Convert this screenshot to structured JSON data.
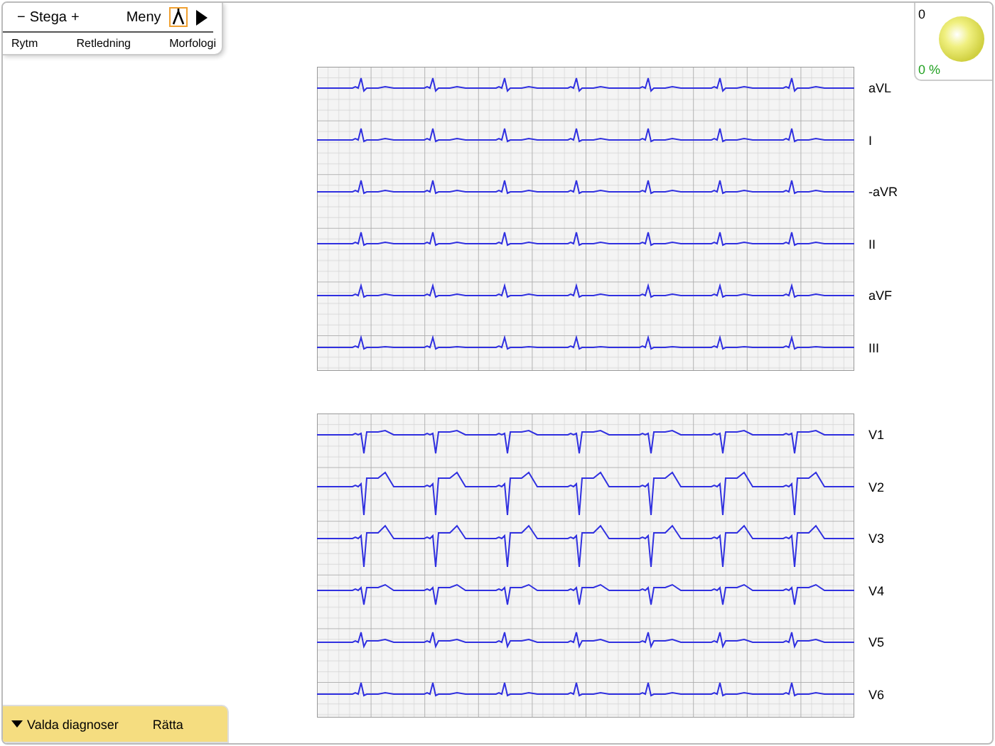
{
  "toolbar": {
    "minus": "−",
    "step_label": "Stega",
    "plus": "+",
    "menu": "Meny",
    "tabs": [
      "Rytm",
      "Retledning",
      "Morfologi"
    ]
  },
  "score": {
    "points": "0",
    "percent": "0 %"
  },
  "ecg_panels": [
    {
      "leads": [
        "aVL",
        "I",
        "-aVR",
        "II",
        "aVF",
        "III"
      ]
    },
    {
      "leads": [
        "V1",
        "V2",
        "V3",
        "V4",
        "V5",
        "V6"
      ]
    }
  ],
  "bottom_bar": {
    "toggle": "Valda diagnoser",
    "check": "Rätta"
  }
}
